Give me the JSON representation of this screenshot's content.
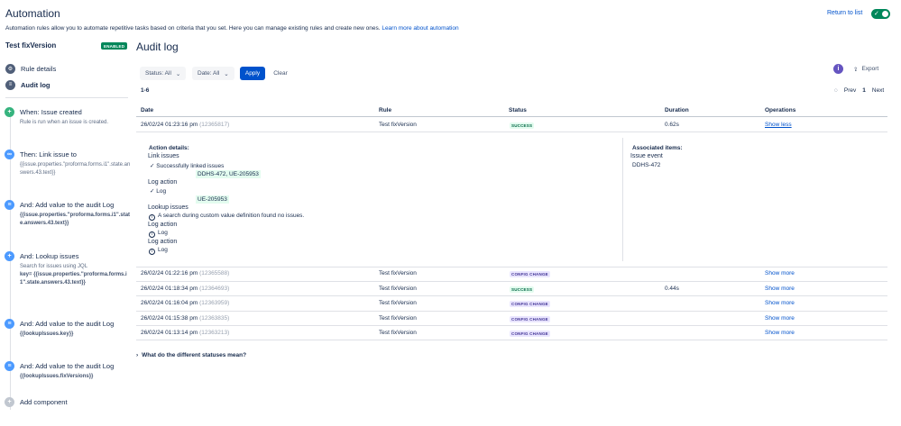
{
  "header": {
    "title": "Automation",
    "description": "Automation rules allow you to automate repetitive tasks based on criteria that you set. Here you can manage existing rules and create new ones.",
    "learn_more": "Learn more about automation",
    "return_link": "Return to list",
    "toggle_on": true
  },
  "sidebar": {
    "rule_name": "Test fixVersion",
    "status_badge": "ENABLED",
    "nav": [
      {
        "label": "Rule details",
        "icon": "gear-icon"
      },
      {
        "label": "Audit log",
        "icon": "document-icon"
      }
    ],
    "components": [
      {
        "title": "When: Issue created",
        "sub": "Rule is run when an issue is created.",
        "icon": "plus-icon",
        "color": "#36b37e"
      },
      {
        "title": "Then: Link issue to",
        "sub": "{{issue.properties.\"proforma.forms.i1\".state.answers.43.text}}",
        "icon": "link-icon",
        "color": "#4c9aff"
      },
      {
        "title": "And: Add value to the audit Log",
        "sub": "{{issue.properties.\"proforma.forms.i1\".state.answers.43.text}}",
        "icon": "list-icon",
        "color": "#4c9aff"
      },
      {
        "title": "And: Lookup issues",
        "sub": "Search for issues using JQL",
        "sub2": "key= {{issue.properties.\"proforma.forms.i1\".state.answers.43.text}}",
        "icon": "plus-icon",
        "color": "#4c9aff"
      },
      {
        "title": "And: Add value to the audit Log",
        "sub": "{{lookupIssues.key}}",
        "icon": "list-icon",
        "color": "#4c9aff"
      },
      {
        "title": "And: Add value to the audit Log",
        "sub": "{{lookupIssues.fixVersions}}",
        "icon": "list-icon",
        "color": "#4c9aff"
      }
    ],
    "add_component": "Add component"
  },
  "main": {
    "title": "Audit log",
    "filters": {
      "status": "Status: All",
      "date": "Date: All",
      "apply": "Apply",
      "clear": "Clear"
    },
    "export": "Export",
    "range": "1-6",
    "pager": {
      "prev": "Prev",
      "page": "1",
      "next": "Next"
    },
    "columns": [
      "Date",
      "Rule",
      "Status",
      "Duration",
      "Operations"
    ],
    "rows": [
      {
        "date": "26/02/24 01:23:16 pm",
        "id": "(12365817)",
        "rule": "Test fixVersion",
        "status": "SUCCESS",
        "status_type": "success",
        "duration": "0.62s",
        "op": "Show less"
      },
      {
        "date": "26/02/24 01:22:16 pm",
        "id": "(12365588)",
        "rule": "Test fixVersion",
        "status": "CONFIG CHANGE",
        "status_type": "config",
        "duration": "",
        "op": "Show more"
      },
      {
        "date": "26/02/24 01:18:34 pm",
        "id": "(12364693)",
        "rule": "Test fixVersion",
        "status": "SUCCESS",
        "status_type": "success",
        "duration": "0.44s",
        "op": "Show more"
      },
      {
        "date": "26/02/24 01:16:04 pm",
        "id": "(12363959)",
        "rule": "Test fixVersion",
        "status": "CONFIG CHANGE",
        "status_type": "config",
        "duration": "",
        "op": "Show more"
      },
      {
        "date": "26/02/24 01:15:38 pm",
        "id": "(12363835)",
        "rule": "Test fixVersion",
        "status": "CONFIG CHANGE",
        "status_type": "config",
        "duration": "",
        "op": "Show more"
      },
      {
        "date": "26/02/24 01:13:14 pm",
        "id": "(12363213)",
        "rule": "Test fixVersion",
        "status": "CONFIG CHANGE",
        "status_type": "config",
        "duration": "",
        "op": "Show more"
      }
    ],
    "details": {
      "action_heading": "Action details:",
      "link_issues": "Link issues",
      "linked_msg": "Successfully linked issues",
      "linked_keys": "DDHS-472, UE-205953",
      "log_action_1": "Log action",
      "log_1": "Log",
      "log_1_value": "UE-205953",
      "lookup_issues": "Lookup issues",
      "lookup_msg": "A search during custom value definition found no issues.",
      "log_action_2": "Log action",
      "log_2": "Log",
      "log_action_3": "Log action",
      "log_3": "Log",
      "assoc_heading": "Associated items:",
      "issue_event": "Issue event",
      "issue_key": "DDHS-472"
    },
    "statuses_question": "What do the different statuses mean?"
  }
}
